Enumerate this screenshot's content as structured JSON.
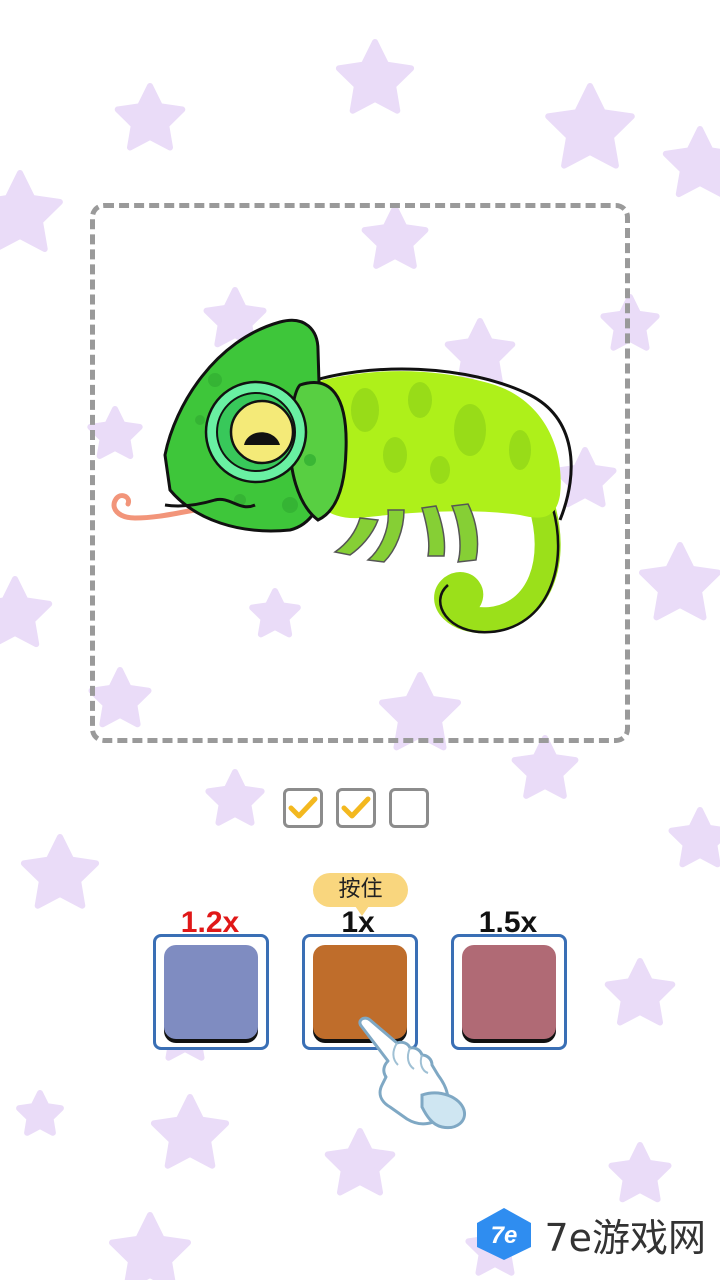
{
  "colors": {
    "background": "#ffffff",
    "star": "#eadcf8",
    "check": "#f3b81f",
    "swatch_border": "#3a6fb5",
    "hint_bubble": "#f9d67e"
  },
  "drawing": {
    "subject_icon": "chameleon-drawing",
    "tongue_color": "#f2957a",
    "head_color": "#3ec63a",
    "body_color": "#aef01a",
    "eye_ring_color": "#69f0a2",
    "eye_color": "#f4ea78"
  },
  "progress": {
    "steps": [
      {
        "done": true
      },
      {
        "done": true
      },
      {
        "done": false
      }
    ]
  },
  "hint": {
    "label": "按住"
  },
  "palette": [
    {
      "multiplier": "1.2x",
      "multiplier_color": "#e01818",
      "color": "#7f8cc1"
    },
    {
      "multiplier": "1x",
      "multiplier_color": "#111111",
      "color": "#bf6d2b"
    },
    {
      "multiplier": "1.5x",
      "multiplier_color": "#111111",
      "color": "#b06a75"
    }
  ],
  "pointer": {
    "icon": "pointing-hand-icon"
  },
  "watermark": {
    "logo": "7e",
    "text": "7e游戏网"
  }
}
